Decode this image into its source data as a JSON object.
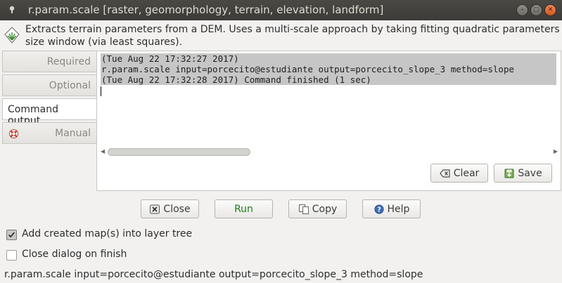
{
  "window": {
    "title": "r.param.scale [raster, geomorphology, terrain, elevation, landform]",
    "controls": [
      "close",
      "minimize",
      "maximize"
    ]
  },
  "description": {
    "line1": "Extracts terrain parameters from a DEM. Uses a multi-scale approach by taking fitting quadratic parameters to a",
    "line2": "size window (via least squares)."
  },
  "tabs": [
    {
      "label": "Required",
      "active": false
    },
    {
      "label": "Optional",
      "active": false
    },
    {
      "label": "Command output",
      "active": true
    },
    {
      "label": "Manual",
      "active": false,
      "icon": "lifebuoy-icon"
    }
  ],
  "console": {
    "lines": [
      "(Tue Aug 22 17:32:27 2017)",
      "r.param.scale input=porcecito@estudiante output=porcecito_slope_3 method=slope",
      "(Tue Aug 22 17:32:28 2017) Command finished (1 sec)"
    ]
  },
  "output_actions": {
    "clear_label": "Clear",
    "save_label": "Save"
  },
  "actions": {
    "close_label": "Close",
    "run_label": "Run",
    "copy_label": "Copy",
    "help_label": "Help"
  },
  "options": {
    "add_to_layer_tree": {
      "label": "Add created map(s) into layer tree",
      "checked": true
    },
    "close_on_finish": {
      "label": "Close dialog on finish",
      "checked": false
    }
  },
  "status": {
    "command": "r.param.scale input=porcecito@estudiante output=porcecito_slope_3 method=slope"
  },
  "colors": {
    "titlebar": "#3c3b37",
    "run_text": "#1e7d1e",
    "selection": "#c6c6c6"
  }
}
